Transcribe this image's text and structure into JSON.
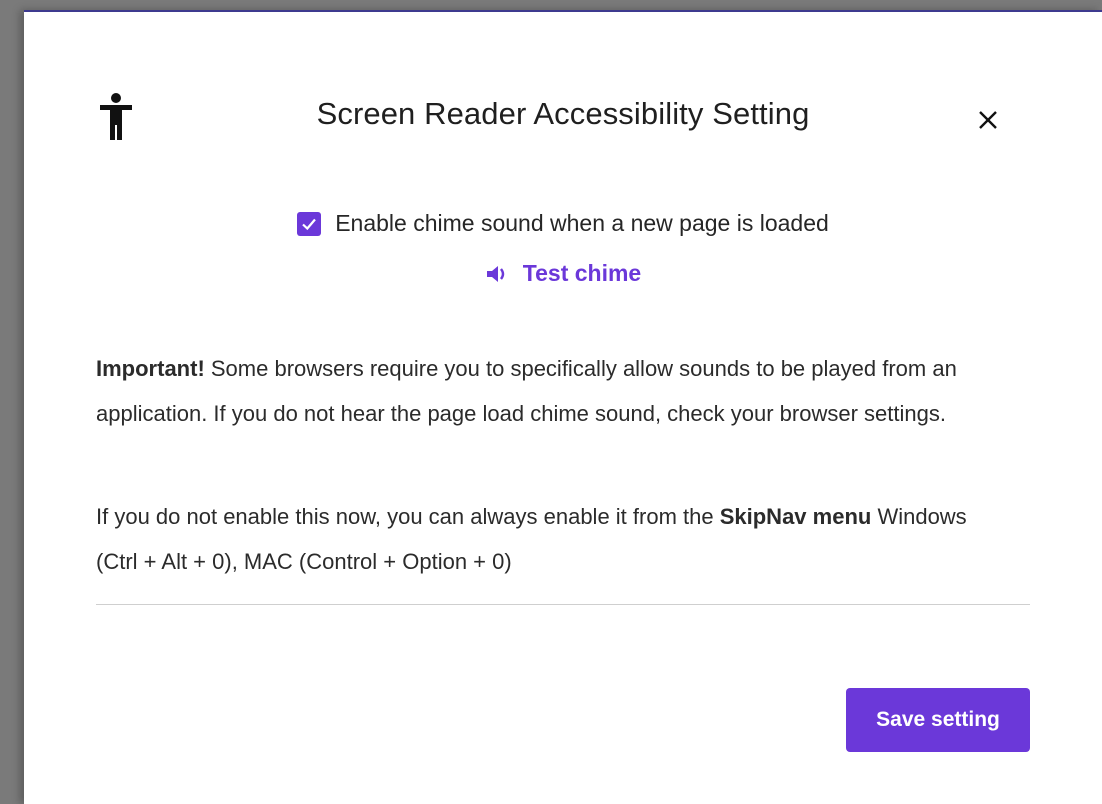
{
  "dialog": {
    "title": "Screen Reader Accessibility Setting",
    "close_icon": "close-icon",
    "accessibility_icon": "accessibility-person-icon"
  },
  "chime": {
    "checkbox_checked": true,
    "label": "Enable chime sound when a new page is loaded",
    "test_label": "Test chime",
    "speaker_icon": "speaker-icon"
  },
  "notice": {
    "important_bold": "Important!",
    "important_text": " Some browsers require you to specifically allow sounds to be played from an application. If you do not hear the page load chime sound, check your browser settings.",
    "enable_prefix": "If you do not enable this now, you can always enable it from the ",
    "skipnav_bold": "SkipNav menu",
    "enable_suffix": " Windows (Ctrl + Alt + 0), MAC (Control + Option + 0)"
  },
  "footer": {
    "save_label": "Save setting"
  },
  "colors": {
    "accent": "#6b38d9",
    "text": "#2b2b2b",
    "divider": "#cfcfcf"
  }
}
